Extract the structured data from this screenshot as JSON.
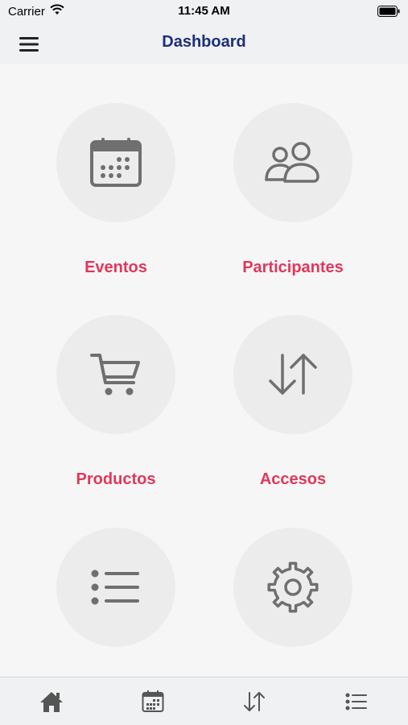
{
  "status_bar": {
    "carrier": "Carrier",
    "time": "11:45 AM"
  },
  "nav": {
    "title": "Dashboard",
    "menu_icon": "hamburger-menu-icon"
  },
  "colors": {
    "accent": "#e0375b",
    "title": "#1b2f7a",
    "icon": "#6f6f6f",
    "circle": "#ececec"
  },
  "tiles": [
    {
      "label": "Eventos",
      "icon": "calendar-icon"
    },
    {
      "label": "Participantes",
      "icon": "users-icon"
    },
    {
      "label": "Productos",
      "icon": "shopping-cart-icon"
    },
    {
      "label": "Accesos",
      "icon": "arrows-up-down-icon"
    },
    {
      "label": "",
      "icon": "list-icon"
    },
    {
      "label": "",
      "icon": "gear-icon"
    }
  ],
  "tabbar": [
    {
      "icon": "home-icon"
    },
    {
      "icon": "calendar-icon"
    },
    {
      "icon": "arrows-up-down-icon"
    },
    {
      "icon": "list-icon"
    }
  ]
}
